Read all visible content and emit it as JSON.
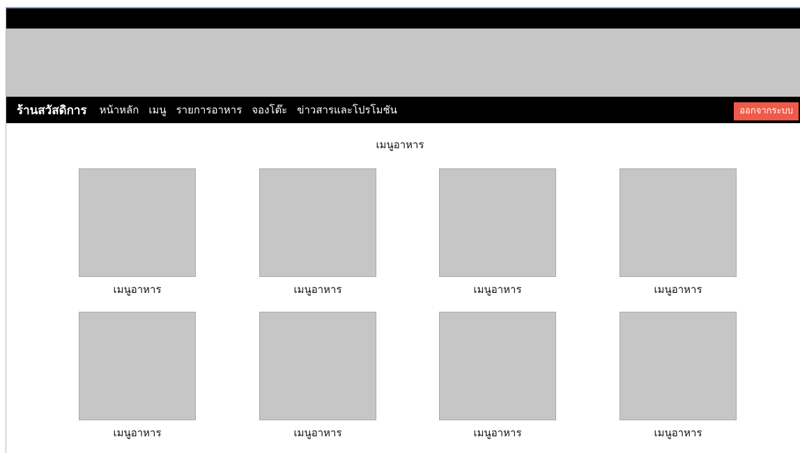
{
  "header": {
    "brand": "ร้านสวัสดิการ",
    "nav": [
      "หน้าหลัก",
      "เมนู",
      "รายการอาหาร",
      "จองโต๊ะ",
      "ข่าวสารและโปรโมชัน"
    ],
    "logout": "ออกจากระบบ"
  },
  "main": {
    "title": "เมนูอาหาร",
    "items": [
      {
        "label": "เมนูอาหาร"
      },
      {
        "label": "เมนูอาหาร"
      },
      {
        "label": "เมนูอาหาร"
      },
      {
        "label": "เมนูอาหาร"
      },
      {
        "label": "เมนูอาหาร"
      },
      {
        "label": "เมนูอาหาร"
      },
      {
        "label": "เมนูอาหาร"
      },
      {
        "label": "เมนูอาหาร"
      }
    ]
  },
  "colors": {
    "topbar": "#000000",
    "banner": "#c6c6c6",
    "logout_bg": "#f05a4a",
    "placeholder": "#c6c6c6"
  }
}
